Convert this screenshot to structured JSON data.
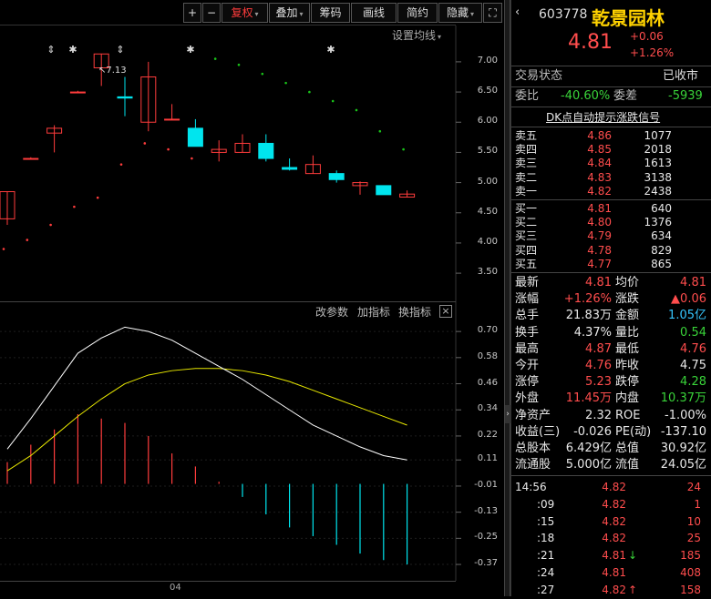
{
  "toolbar": {
    "plus": "+",
    "minus": "−",
    "fuquan": "复权",
    "diejia": "叠加",
    "chouma": "筹码",
    "huaxian": "画线",
    "jianyue": "简约",
    "yincang": "隐藏",
    "expand": "⛶",
    "set_ma": "设置均线"
  },
  "price_axis": [
    "7.00",
    "6.50",
    "6.00",
    "5.50",
    "5.00",
    "4.50",
    "4.00",
    "3.50"
  ],
  "high_label": "7.13",
  "indicator_bar": {
    "change_params": "改参数",
    "add_indicator": "加指标",
    "switch_indicator": "换指标",
    "close": "×"
  },
  "indicator_axis": [
    "0.70",
    "0.58",
    "0.46",
    "0.34",
    "0.22",
    "0.11",
    "-0.01",
    "-0.13",
    "-0.25",
    "-0.37"
  ],
  "x_label": "04",
  "colors": {
    "up": "#ff3c3c",
    "down": "#00e5ee",
    "dif": "#ffffff",
    "dea": "#e8e800",
    "dot": "#19c219"
  },
  "chart_data": {
    "type": "candlestick",
    "price_ylim": [
      3.2,
      7.3
    ],
    "candles": [
      {
        "o": 4.4,
        "c": 4.85,
        "h": 4.85,
        "l": 4.3
      },
      {
        "o": 5.4,
        "c": 5.4,
        "h": 5.42,
        "l": 5.38
      },
      {
        "o": 5.82,
        "c": 5.9,
        "h": 5.95,
        "l": 5.5
      },
      {
        "o": 6.5,
        "c": 6.5,
        "h": 6.52,
        "l": 6.48
      },
      {
        "o": 6.9,
        "c": 7.13,
        "h": 7.13,
        "l": 6.6
      },
      {
        "o": 6.42,
        "c": 6.4,
        "h": 6.75,
        "l": 6.1
      },
      {
        "o": 6.0,
        "c": 6.75,
        "h": 7.0,
        "l": 5.85
      },
      {
        "o": 6.05,
        "c": 6.05,
        "h": 6.3,
        "l": 6.05
      },
      {
        "o": 5.9,
        "c": 5.6,
        "h": 6.05,
        "l": 5.6
      },
      {
        "o": 5.5,
        "c": 5.55,
        "h": 5.7,
        "l": 5.35
      },
      {
        "o": 5.5,
        "c": 5.65,
        "h": 5.8,
        "l": 5.5
      },
      {
        "o": 5.65,
        "c": 5.4,
        "h": 5.8,
        "l": 5.35
      },
      {
        "o": 5.25,
        "c": 5.22,
        "h": 5.4,
        "l": 5.2
      },
      {
        "o": 5.15,
        "c": 5.3,
        "h": 5.45,
        "l": 5.15
      },
      {
        "o": 5.15,
        "c": 5.05,
        "h": 5.2,
        "l": 5.0
      },
      {
        "o": 4.95,
        "c": 5.0,
        "h": 5.02,
        "l": 4.8
      },
      {
        "o": 4.95,
        "c": 4.8,
        "h": 4.95,
        "l": 4.8
      },
      {
        "o": 4.76,
        "c": 4.81,
        "h": 4.87,
        "l": 4.76
      }
    ],
    "signal_dots": [
      3.9,
      4.05,
      4.3,
      4.6,
      4.75,
      5.3,
      5.65,
      5.55,
      5.4,
      7.05,
      6.95,
      6.8,
      6.65,
      6.5,
      6.35,
      6.2,
      5.85,
      5.55
    ],
    "macd_ylim": [
      -0.42,
      0.78
    ],
    "dif": [
      0.16,
      0.3,
      0.45,
      0.6,
      0.67,
      0.72,
      0.7,
      0.66,
      0.6,
      0.54,
      0.48,
      0.41,
      0.34,
      0.27,
      0.22,
      0.17,
      0.13,
      0.11
    ],
    "dea": [
      0.06,
      0.13,
      0.22,
      0.31,
      0.39,
      0.46,
      0.5,
      0.52,
      0.53,
      0.53,
      0.52,
      0.5,
      0.47,
      0.43,
      0.39,
      0.35,
      0.31,
      0.27
    ],
    "macd": [
      0.1,
      0.18,
      0.25,
      0.32,
      0.3,
      0.28,
      0.22,
      0.14,
      0.08,
      0.01,
      -0.06,
      -0.14,
      -0.2,
      -0.24,
      -0.28,
      -0.32,
      -0.35,
      -0.37
    ]
  },
  "stock": {
    "code": "603778",
    "name": "乾景园林",
    "price": "4.81",
    "change": "+0.06",
    "change_pct": "+1.26%"
  },
  "trade_status": {
    "label": "交易状态",
    "value": "已收市"
  },
  "weibi": {
    "label1": "委比",
    "value1": "-40.60%",
    "label2": "委差",
    "value2": "-5939"
  },
  "dk_signal": "DK点自动提示涨跌信号",
  "asks": [
    {
      "label": "卖五",
      "price": "4.86",
      "vol": "1077"
    },
    {
      "label": "卖四",
      "price": "4.85",
      "vol": "2018"
    },
    {
      "label": "卖三",
      "price": "4.84",
      "vol": "1613"
    },
    {
      "label": "卖二",
      "price": "4.83",
      "vol": "3138"
    },
    {
      "label": "卖一",
      "price": "4.82",
      "vol": "2438"
    }
  ],
  "bids": [
    {
      "label": "买一",
      "price": "4.81",
      "vol": "640"
    },
    {
      "label": "买二",
      "price": "4.80",
      "vol": "1376"
    },
    {
      "label": "买三",
      "price": "4.79",
      "vol": "634"
    },
    {
      "label": "买四",
      "price": "4.78",
      "vol": "829"
    },
    {
      "label": "买五",
      "price": "4.77",
      "vol": "865"
    }
  ],
  "quote": [
    {
      "l1": "最新",
      "v1": "4.81",
      "c1": "red",
      "l2": "均价",
      "v2": "4.81",
      "c2": "red"
    },
    {
      "l1": "涨幅",
      "v1": "+1.26%",
      "c1": "red",
      "l2": "涨跌",
      "v2": "▲0.06",
      "c2": "red"
    },
    {
      "l1": "总手",
      "v1": "21.83万",
      "c1": "white",
      "l2": "金额",
      "v2": "1.05亿",
      "c2": "cyan"
    },
    {
      "l1": "换手",
      "v1": "4.37%",
      "c1": "white",
      "l2": "量比",
      "v2": "0.54",
      "c2": "green"
    },
    {
      "l1": "最高",
      "v1": "4.87",
      "c1": "red",
      "l2": "最低",
      "v2": "4.76",
      "c2": "red"
    },
    {
      "l1": "今开",
      "v1": "4.76",
      "c1": "red",
      "l2": "昨收",
      "v2": "4.75",
      "c2": "white"
    },
    {
      "l1": "涨停",
      "v1": "5.23",
      "c1": "red",
      "l2": "跌停",
      "v2": "4.28",
      "c2": "green"
    },
    {
      "l1": "外盘",
      "v1": "11.45万",
      "c1": "red",
      "l2": "内盘",
      "v2": "10.37万",
      "c2": "green"
    },
    {
      "l1": "净资产",
      "v1": "2.32",
      "c1": "white",
      "l2": "ROE",
      "v2": "-1.00%",
      "c2": "white"
    },
    {
      "l1": "收益(三)",
      "v1": "-0.026",
      "c1": "white",
      "l2": "PE(动)",
      "v2": "-137.10",
      "c2": "white"
    },
    {
      "l1": "总股本",
      "v1": "6.429亿",
      "c1": "white",
      "l2": "总值",
      "v2": "30.92亿",
      "c2": "white"
    },
    {
      "l1": "流通股",
      "v1": "5.000亿",
      "c1": "white",
      "l2": "流值",
      "v2": "24.05亿",
      "c2": "white"
    }
  ],
  "ticks": [
    {
      "time": "14:56",
      "price": "4.82",
      "dir": "",
      "vol": "24"
    },
    {
      "time": ":09",
      "price": "4.82",
      "dir": "",
      "vol": "1"
    },
    {
      "time": ":15",
      "price": "4.82",
      "dir": "",
      "vol": "10"
    },
    {
      "time": ":18",
      "price": "4.82",
      "dir": "",
      "vol": "25"
    },
    {
      "time": ":21",
      "price": "4.81",
      "dir": "↓",
      "vol": "185"
    },
    {
      "time": ":24",
      "price": "4.81",
      "dir": "",
      "vol": "408"
    },
    {
      "time": ":27",
      "price": "4.82",
      "dir": "↑",
      "vol": "158"
    }
  ]
}
